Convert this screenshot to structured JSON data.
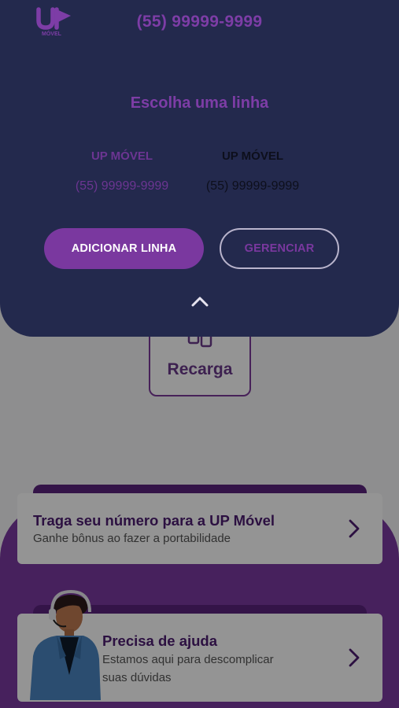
{
  "header": {
    "logo_text": "UP",
    "logo_sub": "MÓVEL",
    "phone": "(55) 99999-9999"
  },
  "line_selector": {
    "title": "Escolha uma linha",
    "lines": [
      {
        "name": "UP MÓVEL",
        "number": "(55) 99999-9999"
      },
      {
        "name": "UP MÓVEL",
        "number": "(55) 99999-9999"
      }
    ],
    "add_button": "ADICIONAR LINHA",
    "manage_button": "GERENCIAR",
    "collapse_icon": "chevron-up-icon"
  },
  "shortcuts": {
    "recharge_label": "Recarga",
    "recharge_icon": "phone-recharge-icon"
  },
  "cards": {
    "portability": {
      "title": "Traga seu número para a UP Móvel",
      "subtitle": "Ganhe bônus ao fazer a portabilidade"
    },
    "help": {
      "title": "Precisa de ajuda",
      "subtitle_line1": "Estamos aqui para descomplicar",
      "subtitle_line2": "suas dúvidas"
    }
  },
  "colors": {
    "brand_purple": "#7a389f",
    "panel_navy": "#23294d"
  }
}
